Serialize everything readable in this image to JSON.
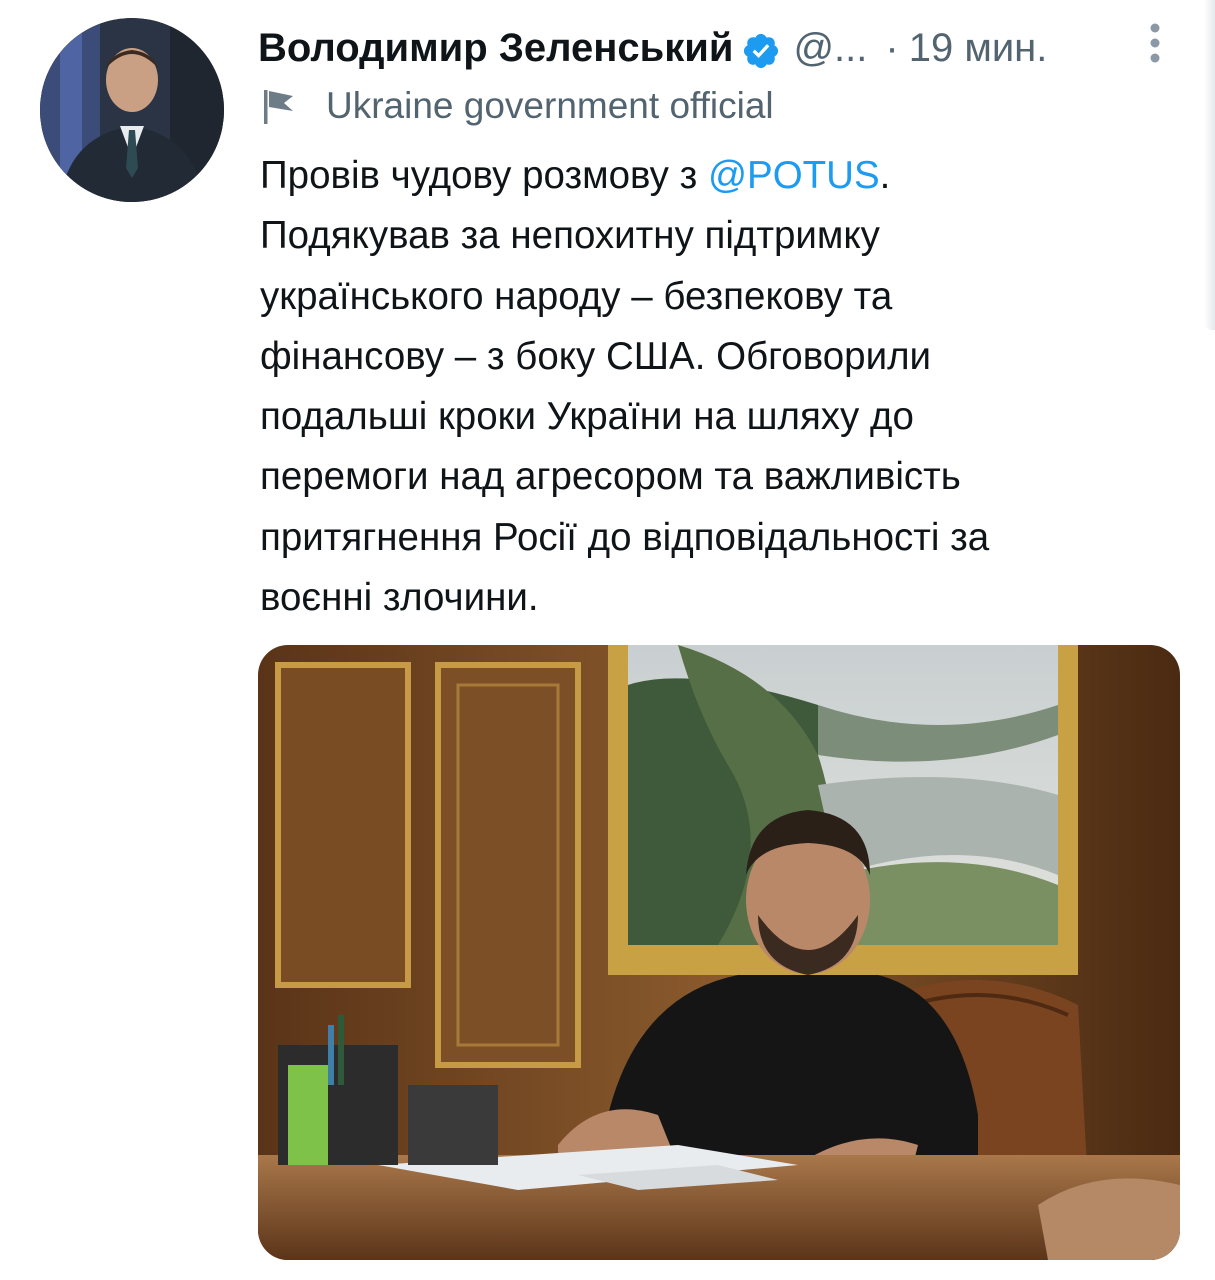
{
  "tweet": {
    "author": {
      "display_name": "Володимир Зеленський",
      "handle": "@...",
      "verified": true
    },
    "separator": "·",
    "timestamp": "19 мин.",
    "account_label": "Ukraine government official",
    "text": {
      "line1_before_mention": "Провів чудову розмову з ",
      "mention": "@POTUS",
      "line1_after_mention": ".",
      "lines": [
        "Подякував за непохитну підтримку",
        "українського народу – безпекову та",
        "фінансову – з боку США. Обговорили",
        "подальші кроки України на шляху до",
        "перемоги над агресором та важливість",
        "притягнення Росії до відповідальності за",
        "воєнні злочини."
      ]
    },
    "icons": {
      "verified": "verified-badge-icon",
      "more": "more-vertical-icon",
      "label": "flag-icon"
    }
  },
  "colors": {
    "text_primary": "#0f1419",
    "text_secondary": "#536471",
    "link": "#1d9bf0"
  }
}
